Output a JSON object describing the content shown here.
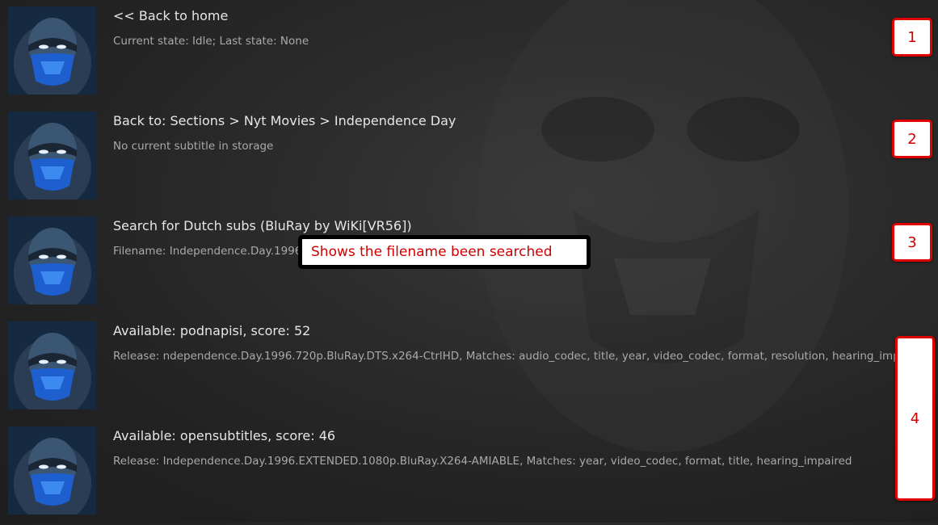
{
  "items": [
    {
      "title": "<< Back to home",
      "subtitle": "Current state: Idle; Last state: None"
    },
    {
      "title": "Back to: Sections > Nyt Movies > Independence Day",
      "subtitle": "No current subtitle in storage"
    },
    {
      "title": "Search for Dutch subs (BluRay by WiKi[VR56])",
      "subtitle": "Filename: Independence.Day.1996."
    },
    {
      "title": "Available: podnapisi, score: 52",
      "subtitle": "Release: ndependence.Day.1996.720p.BluRay.DTS.x264-CtrlHD, Matches: audio_codec, title, year, video_codec, format, resolution, hearing_impaired"
    },
    {
      "title": "Available: opensubtitles, score: 46",
      "subtitle": "Release: Independence.Day.1996.EXTENDED.1080p.BluRay.X264-AMIABLE, Matches: year, video_codec, format, title, hearing_impaired"
    }
  ],
  "annotations": {
    "badge_1": "1",
    "badge_2": "2",
    "badge_3": "3",
    "badge_4": "4",
    "callout": "Shows the filename been searched"
  },
  "colors": {
    "annotation_red": "#e00000",
    "title_text": "#e6e6e6",
    "subtitle_text": "#a9a9a9",
    "thumbnail_mask_blue": "#1e5fd0"
  },
  "icons": {
    "thumbnail": "ninja-masked-face-thumbnail"
  }
}
